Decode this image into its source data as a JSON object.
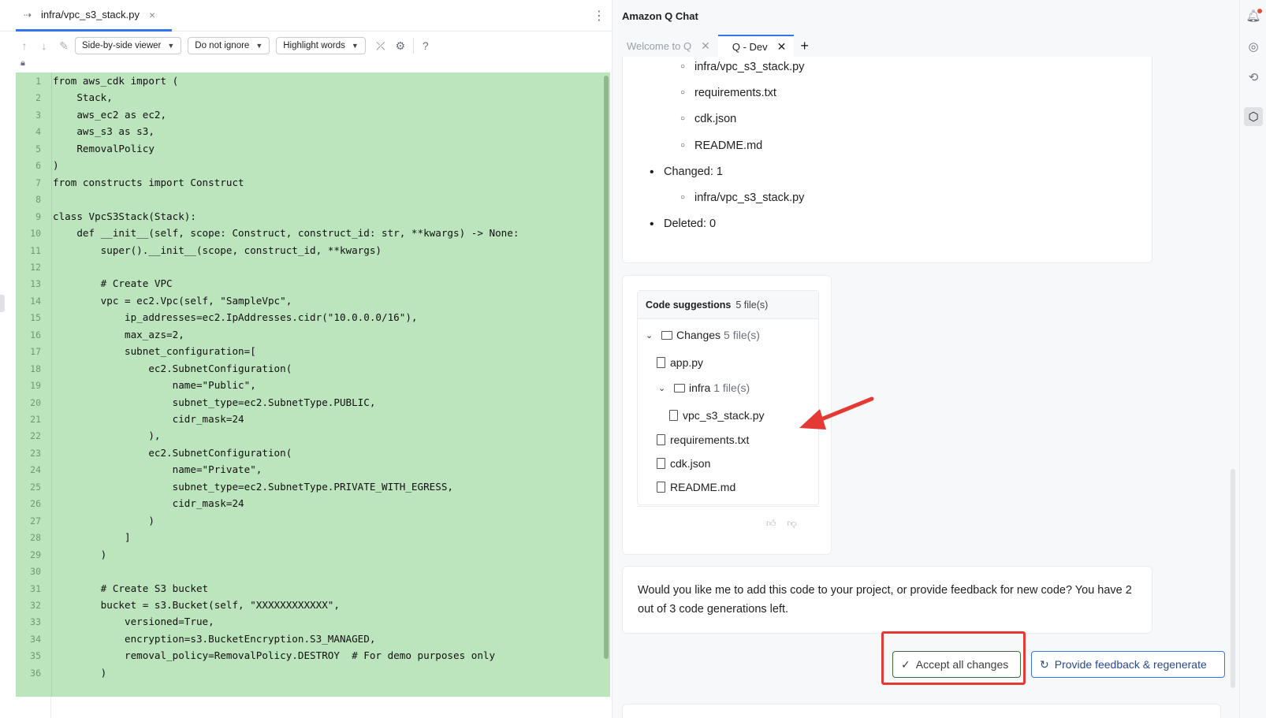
{
  "editor": {
    "tab_label": "infra/vpc_s3_stack.py",
    "toolbar": {
      "viewer_mode": "Side-by-side viewer",
      "ignore_mode": "Do not ignore",
      "highlight_mode": "Highlight words",
      "help": "?"
    },
    "lines": [
      "from aws_cdk import (",
      "    Stack,",
      "    aws_ec2 as ec2,",
      "    aws_s3 as s3,",
      "    RemovalPolicy",
      ")",
      "from constructs import Construct",
      "",
      "class VpcS3Stack(Stack):",
      "    def __init__(self, scope: Construct, construct_id: str, **kwargs) -> None:",
      "        super().__init__(scope, construct_id, **kwargs)",
      "",
      "        # Create VPC",
      "        vpc = ec2.Vpc(self, \"SampleVpc\",",
      "            ip_addresses=ec2.IpAddresses.cidr(\"10.0.0.0/16\"),",
      "            max_azs=2,",
      "            subnet_configuration=[",
      "                ec2.SubnetConfiguration(",
      "                    name=\"Public\",",
      "                    subnet_type=ec2.SubnetType.PUBLIC,",
      "                    cidr_mask=24",
      "                ),",
      "                ec2.SubnetConfiguration(",
      "                    name=\"Private\",",
      "                    subnet_type=ec2.SubnetType.PRIVATE_WITH_EGRESS,",
      "                    cidr_mask=24",
      "                )",
      "            ]",
      "        )",
      "",
      "        # Create S3 bucket",
      "        bucket = s3.Bucket(self, \"XXXXXXXXXXXX\",",
      "            versioned=True,",
      "            encryption=s3.BucketEncryption.S3_MANAGED,",
      "            removal_policy=RemovalPolicy.DESTROY  # For demo purposes only",
      "        )"
    ]
  },
  "chat": {
    "title": "Amazon Q Chat",
    "tabs": [
      {
        "label": "Welcome to Q"
      },
      {
        "label": "Q - Dev"
      }
    ],
    "summary": {
      "created_files": [
        "infra/vpc_s3_stack.py",
        "requirements.txt",
        "cdk.json",
        "README.md"
      ],
      "changed_label": "Changed: 1",
      "changed_files": [
        "infra/vpc_s3_stack.py"
      ],
      "deleted_label": "Deleted: 0"
    },
    "code_suggestions": {
      "title": "Code suggestions",
      "count": "5 file(s)",
      "changes_label": "Changes",
      "changes_count": "5 file(s)",
      "app_file": "app.py",
      "infra_label": "infra",
      "infra_count": "1 file(s)",
      "infra_file": "vpc_s3_stack.py",
      "other_files": [
        "requirements.txt",
        "cdk.json",
        "README.md"
      ]
    },
    "question": "Would you like me to add this code to your project, or provide feedback for new code? You have 2 out of 3 code generations left.",
    "accept_label": "Accept all changes",
    "regenerate_label": "Provide feedback & regenerate"
  },
  "colors": {
    "added_bg": "#bce4bd",
    "accent": "#3574f0",
    "annotation": "#e53935"
  }
}
